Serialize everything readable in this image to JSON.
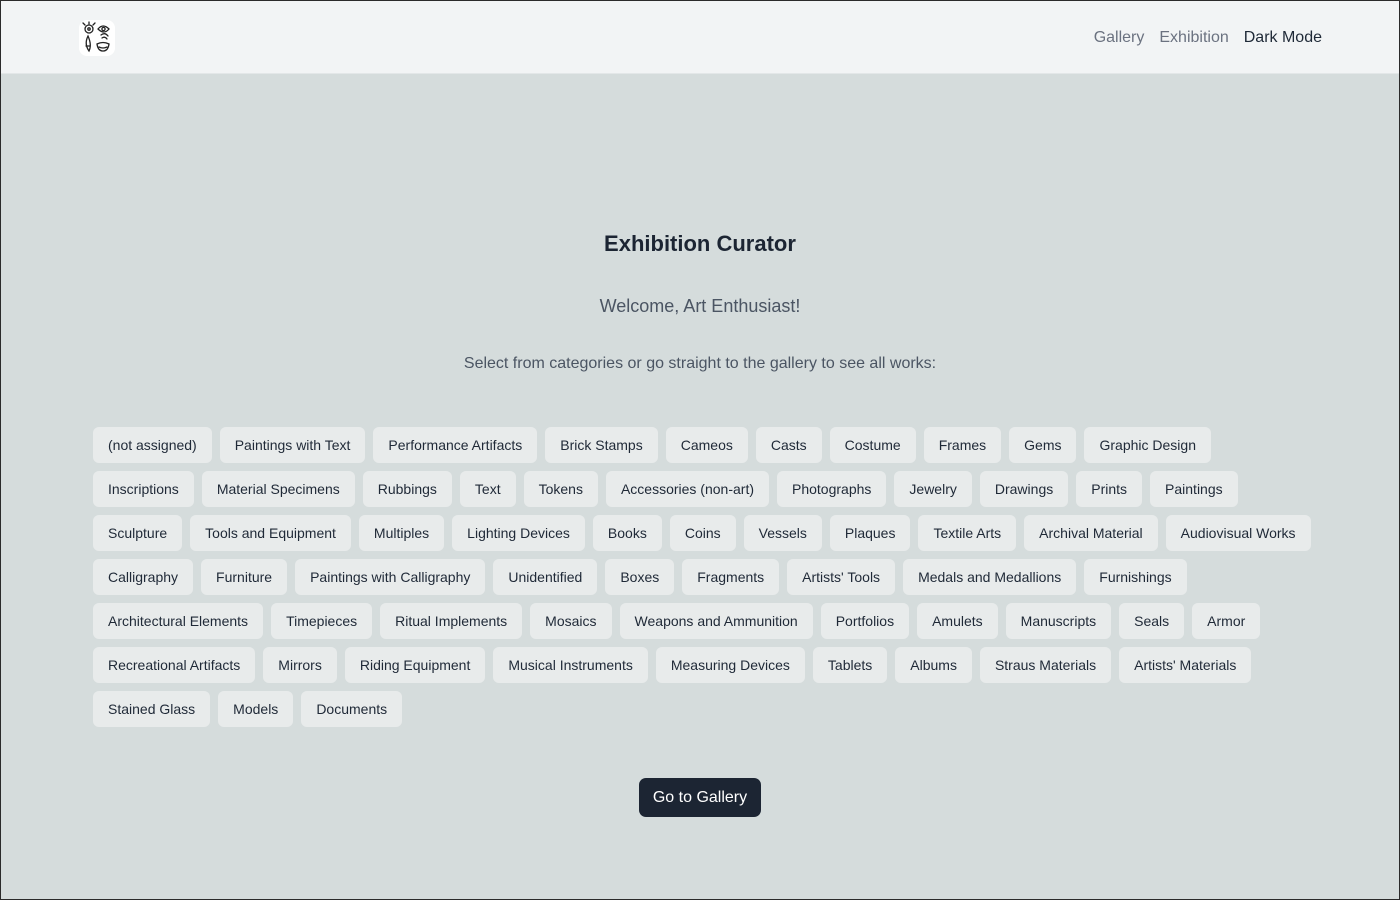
{
  "header": {
    "logo_icon": "art-faces-logo-icon",
    "nav": [
      {
        "label": "Gallery"
      },
      {
        "label": "Exhibition"
      },
      {
        "label": "Dark Mode"
      }
    ]
  },
  "main": {
    "title": "Exhibition Curator",
    "welcome": "Welcome, Art Enthusiast!",
    "instruction": "Select from categories or go straight to the gallery to see all works:",
    "categories": [
      "(not assigned)",
      "Paintings with Text",
      "Performance Artifacts",
      "Brick Stamps",
      "Cameos",
      "Casts",
      "Costume",
      "Frames",
      "Gems",
      "Graphic Design",
      "Inscriptions",
      "Material Specimens",
      "Rubbings",
      "Text",
      "Tokens",
      "Accessories (non-art)",
      "Photographs",
      "Jewelry",
      "Drawings",
      "Prints",
      "Paintings",
      "Sculpture",
      "Tools and Equipment",
      "Multiples",
      "Lighting Devices",
      "Books",
      "Coins",
      "Vessels",
      "Plaques",
      "Textile Arts",
      "Archival Material",
      "Audiovisual Works",
      "Calligraphy",
      "Furniture",
      "Paintings with Calligraphy",
      "Unidentified",
      "Boxes",
      "Fragments",
      "Artists' Tools",
      "Medals and Medallions",
      "Furnishings",
      "Architectural Elements",
      "Timepieces",
      "Ritual Implements",
      "Mosaics",
      "Weapons and Ammunition",
      "Portfolios",
      "Amulets",
      "Manuscripts",
      "Seals",
      "Armor",
      "Recreational Artifacts",
      "Mirrors",
      "Riding Equipment",
      "Musical Instruments",
      "Measuring Devices",
      "Tablets",
      "Albums",
      "Straus Materials",
      "Artists' Materials",
      "Stained Glass",
      "Models",
      "Documents"
    ],
    "gallery_button": "Go to Gallery"
  },
  "colors": {
    "page_background": "#d5dcdc",
    "navbar_background": "#f2f4f5",
    "chip_background": "#e8ebeb",
    "primary_button": "#1c2533"
  }
}
